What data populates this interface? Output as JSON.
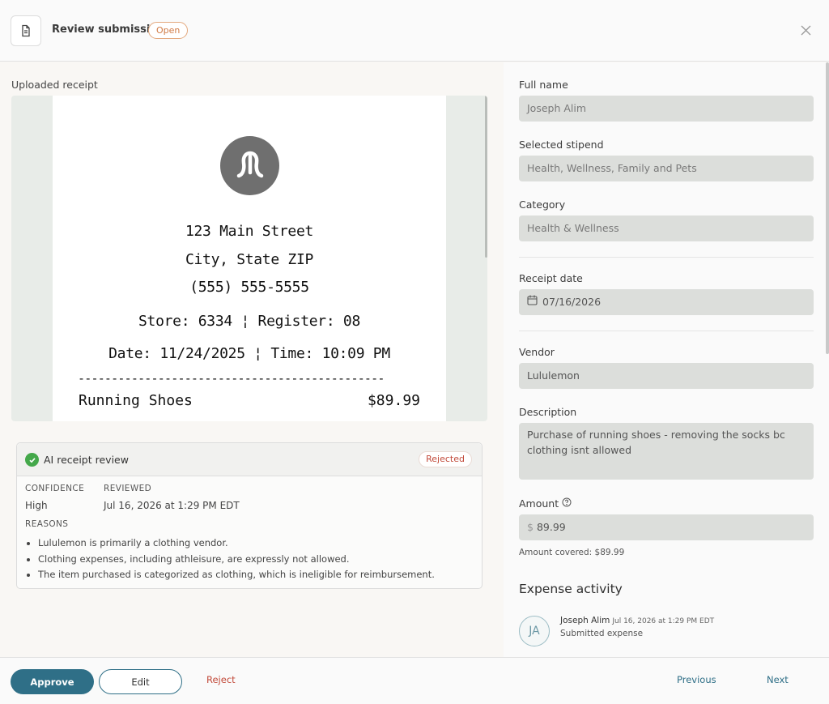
{
  "header": {
    "title": "Review submission",
    "status": "Open",
    "colors": {
      "status": "#d07a45"
    }
  },
  "receipt": {
    "label": "Uploaded receipt",
    "logo_icon": "lululemon-logo",
    "address1": "123 Main Street",
    "address2": "City, State ZIP",
    "phone": "(555) 555-5555",
    "store_line": "Store: 6334 ¦ Register: 08",
    "date_line": "Date: 11/24/2025 ¦ Time: 10:09 PM",
    "dashes": "----------------------------------------------",
    "item_name": "Running Shoes",
    "item_price": "$89.99"
  },
  "ai_review": {
    "title": "AI receipt review",
    "status": "Rejected",
    "confidence_label": "CONFIDENCE",
    "confidence_value": "High",
    "reviewed_label": "REVIEWED",
    "reviewed_value": "Jul 16, 2026 at 1:29 PM EDT",
    "reasons_label": "REASONS",
    "reasons": [
      "Lululemon is primarily a clothing vendor.",
      "Clothing expenses, including athleisure, are expressly not allowed.",
      "The item purchased is categorized as clothing, which is ineligible for reimbursement."
    ]
  },
  "form": {
    "full_name": {
      "label": "Full name",
      "value": "Joseph Alim"
    },
    "stipend": {
      "label": "Selected stipend",
      "value": "Health, Wellness, Family and Pets"
    },
    "category": {
      "label": "Category",
      "value": "Health & Wellness"
    },
    "receipt_date": {
      "label": "Receipt date",
      "value": "07/16/2026"
    },
    "vendor": {
      "label": "Vendor",
      "value": "Lululemon"
    },
    "description": {
      "label": "Description",
      "value": "Purchase of running shoes - removing the socks bc clothing isnt allowed"
    },
    "amount": {
      "label": "Amount",
      "currency": "$",
      "value": "89.99"
    },
    "amount_covered": "Amount covered: $89.99"
  },
  "activity": {
    "title": "Expense activity",
    "items": [
      {
        "initials": "JA",
        "name": "Joseph Alim",
        "time": "Jul 16, 2026 at 1:29 PM EDT",
        "action": "Submitted expense"
      }
    ]
  },
  "footer": {
    "approve": "Approve",
    "edit": "Edit",
    "reject": "Reject",
    "previous": "Previous",
    "next": "Next",
    "colors": {
      "primary": "#2f6f87",
      "danger": "#c24a3a"
    }
  }
}
